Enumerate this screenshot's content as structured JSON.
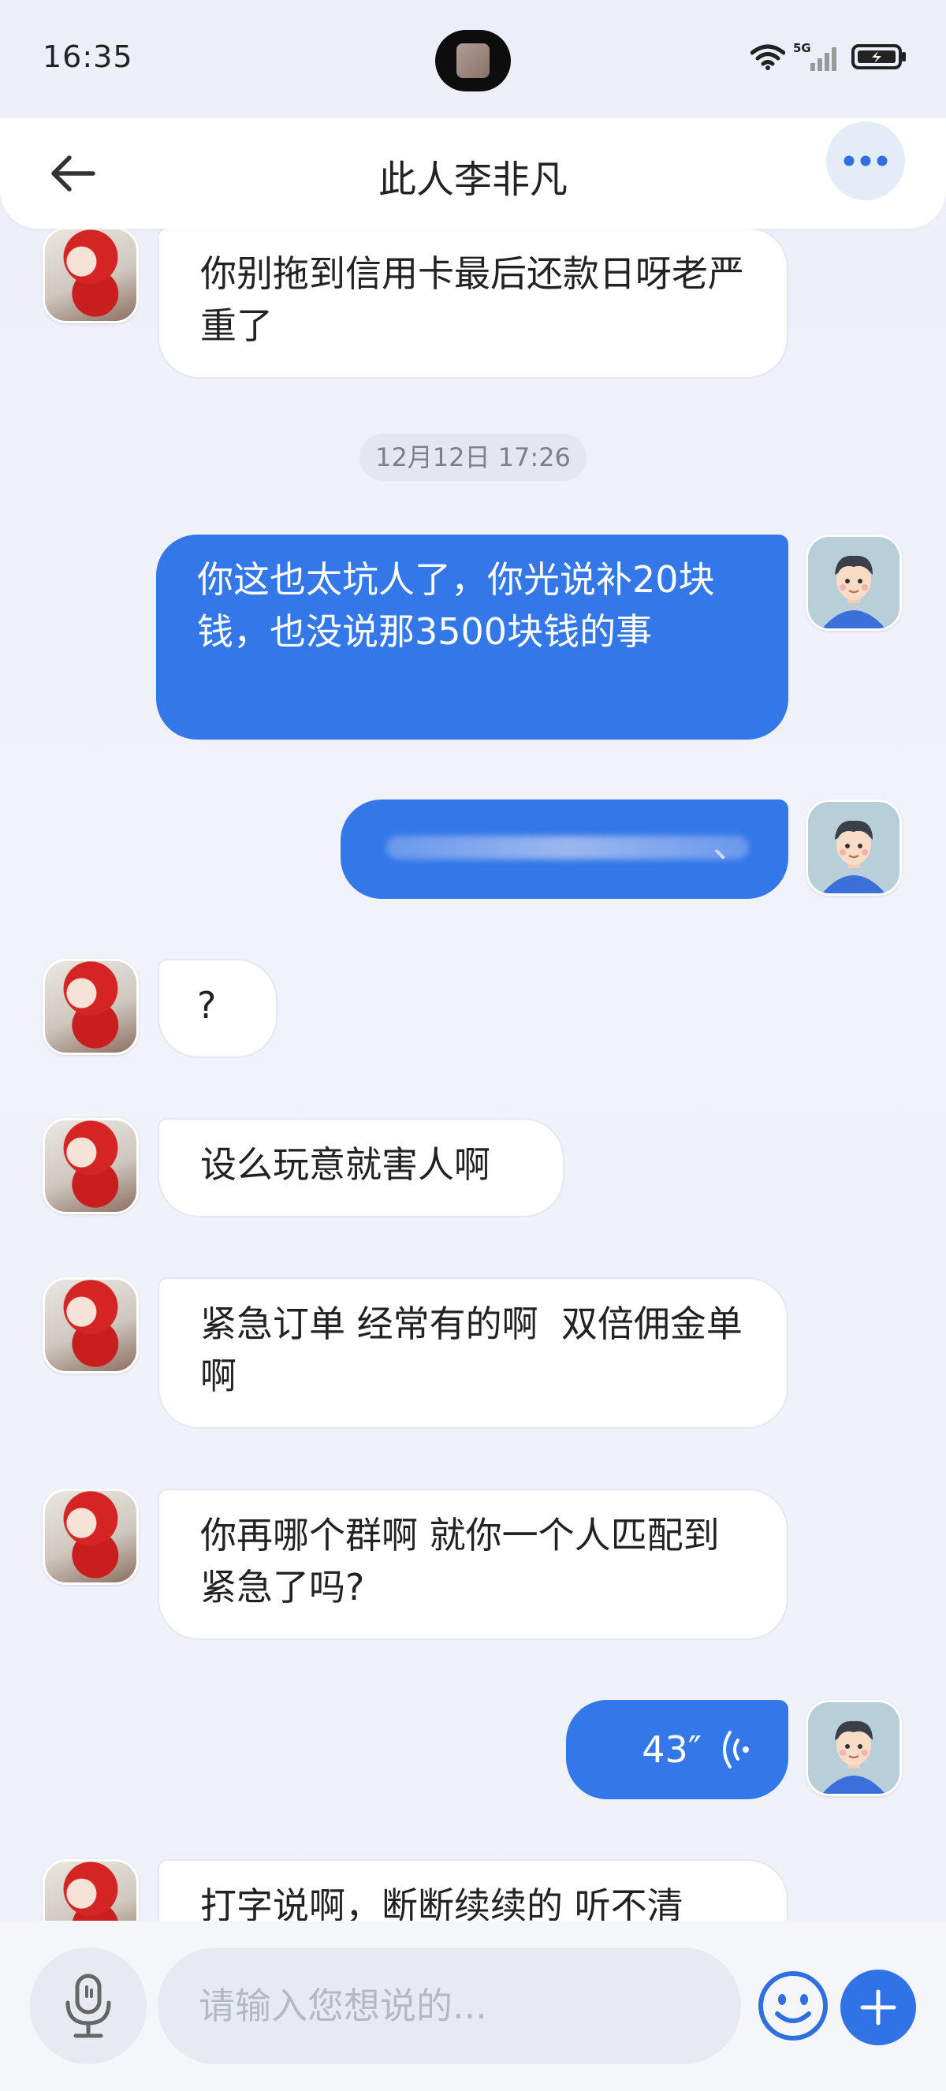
{
  "status_bar": {
    "time": "16:35",
    "network": "5G"
  },
  "header": {
    "back_icon": "arrow-left-icon",
    "title": "此人李非凡",
    "more_icon": "more-dots-icon"
  },
  "messages": [
    {
      "side": "other",
      "text": "你别拖到信用卡最后还款日呀老严重了"
    },
    {
      "type": "timestamp",
      "text": "12月12日 17:26"
    },
    {
      "side": "self",
      "text": "你这也太坑人了，你光说补20块钱，也没说那3500块钱的事"
    },
    {
      "side": "self",
      "text": "、",
      "note_visible": "blurred"
    },
    {
      "side": "other",
      "text": "?"
    },
    {
      "side": "other",
      "text": "设么玩意就害人啊"
    },
    {
      "side": "other",
      "text": "紧急订单 经常有的啊  双倍佣金单 啊"
    },
    {
      "side": "other",
      "text": "你再哪个群啊 就你一个人匹配到紧急了吗?"
    },
    {
      "side": "self",
      "type": "voice",
      "duration": "43″",
      "icon": "voice-wave-icon"
    },
    {
      "side": "other",
      "text": "打字说啊，断断续续的 听不清"
    }
  ],
  "input_bar": {
    "mic_icon": "microphone-icon",
    "placeholder": "请输入您想说的...",
    "emoji_icon": "smiley-icon",
    "plus_icon": "plus-icon"
  },
  "colors": {
    "self_bubble": "#3377e8",
    "other_bubble": "#ffffff",
    "accent": "#2f73e6"
  }
}
